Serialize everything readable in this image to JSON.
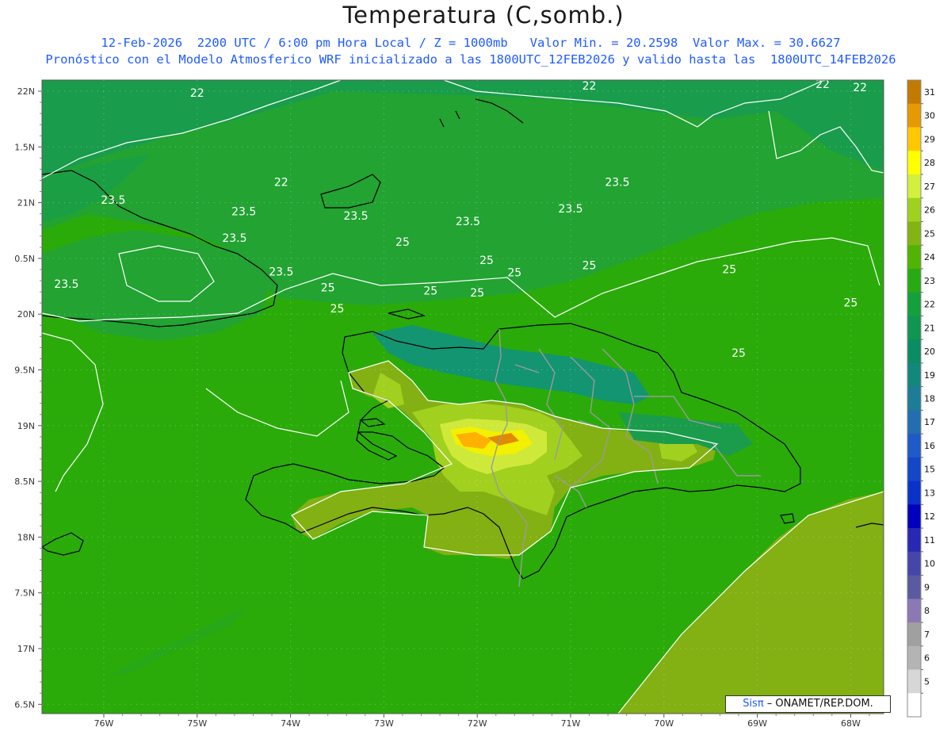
{
  "title": "Temperatura (C,somb.)",
  "subtitle_line1": "12-Feb-2026  2200 UTC / 6:00 pm Hora Local / Z = 1000mb   Valor Min. = 20.2598  Valor Max. = 30.6627",
  "subtitle_line2": "Pronóstico con el Modelo Atmosferico WRF inicializado a las 1800UTC_12FEB2026 y valido hasta las  1800UTC_14FEB2026",
  "credit": {
    "logo": "Sisπ",
    "text": " – ONAMET/REP.DOM."
  },
  "map": {
    "lat_labels": [
      "22N",
      "1.5N",
      "21N",
      "0.5N",
      "20N",
      "9.5N",
      "19N",
      "8.5N",
      "18N",
      "7.5N",
      "17N",
      "6.5N"
    ],
    "lon_labels": [
      "76W",
      "75W",
      "74W",
      "73W",
      "72W",
      "71W",
      "70W",
      "69W",
      "68W"
    ],
    "contour_labels": [
      {
        "text": "22",
        "lon": -75.0,
        "lat": 21.9
      },
      {
        "text": "22",
        "lon": -70.8,
        "lat": 22.03
      },
      {
        "text": "22",
        "lon": -68.3,
        "lat": 22.06
      },
      {
        "text": "22",
        "lon": -67.9,
        "lat": 22.0
      },
      {
        "text": "22",
        "lon": -74.1,
        "lat": 20.3
      },
      {
        "text": "23.5",
        "lon": -75.9,
        "lat": 19.98
      },
      {
        "text": "23.5",
        "lon": -74.5,
        "lat": 19.78
      },
      {
        "text": "23.5",
        "lon": -73.3,
        "lat": 19.7
      },
      {
        "text": "23.5",
        "lon": -72.1,
        "lat": 19.6
      },
      {
        "text": "23.5",
        "lon": -74.6,
        "lat": 19.3
      },
      {
        "text": "23.5",
        "lon": -70.5,
        "lat": 20.3
      },
      {
        "text": "23.5",
        "lon": -71.0,
        "lat": 19.83
      },
      {
        "text": "23.5",
        "lon": -76.4,
        "lat": 18.48
      },
      {
        "text": "23.5",
        "lon": -74.1,
        "lat": 18.7
      },
      {
        "text": "25",
        "lon": -72.8,
        "lat": 19.23
      },
      {
        "text": "25",
        "lon": -71.9,
        "lat": 18.9
      },
      {
        "text": "25",
        "lon": -71.6,
        "lat": 18.68
      },
      {
        "text": "25",
        "lon": -70.8,
        "lat": 18.81
      },
      {
        "text": "25",
        "lon": -69.3,
        "lat": 18.74
      },
      {
        "text": "25",
        "lon": -73.6,
        "lat": 18.41
      },
      {
        "text": "25",
        "lon": -72.5,
        "lat": 18.36
      },
      {
        "text": "25",
        "lon": -72.0,
        "lat": 18.32
      },
      {
        "text": "25",
        "lon": -73.5,
        "lat": 18.04
      },
      {
        "text": "25",
        "lon": -68.0,
        "lat": 18.14
      },
      {
        "text": "25",
        "lon": -69.2,
        "lat": 17.24
      }
    ]
  },
  "colorbar": {
    "labels": [
      "31",
      "30",
      "29",
      "28",
      "27",
      "26",
      "25",
      "24",
      "23",
      "22",
      "21",
      "20",
      "19",
      "18",
      "17",
      "16",
      "15",
      "13",
      "12",
      "11",
      "10",
      "9",
      "8",
      "7",
      "6",
      "5"
    ],
    "colors": [
      "#c27a00",
      "#e49a00",
      "#ffc800",
      "#ffff00",
      "#d2f03c",
      "#9ed21e",
      "#82b414",
      "#50b400",
      "#28aa14",
      "#14a03c",
      "#0f9650",
      "#0a8c64",
      "#14877d",
      "#1e7d96",
      "#236eaf",
      "#1e5ac8",
      "#1446c8",
      "#0a32c8",
      "#0000be",
      "#2828b4",
      "#4646aa",
      "#5a5aa0",
      "#8c78b4",
      "#a0a0a0",
      "#b4b4b4",
      "#d7d7d7",
      "#ffffff"
    ]
  },
  "colors": {
    "sea_24": "#2aab0a",
    "sea_23": "#1f9a3c",
    "sea_22": "#17924e",
    "land_25": "#83b013",
    "land_26": "#9ed21e",
    "hot_27": "#c8e832",
    "hot_28": "#f0f000",
    "hot_29": "#ffb000",
    "hot_31": "#d07000",
    "mountain_21": "#0f9a70"
  }
}
